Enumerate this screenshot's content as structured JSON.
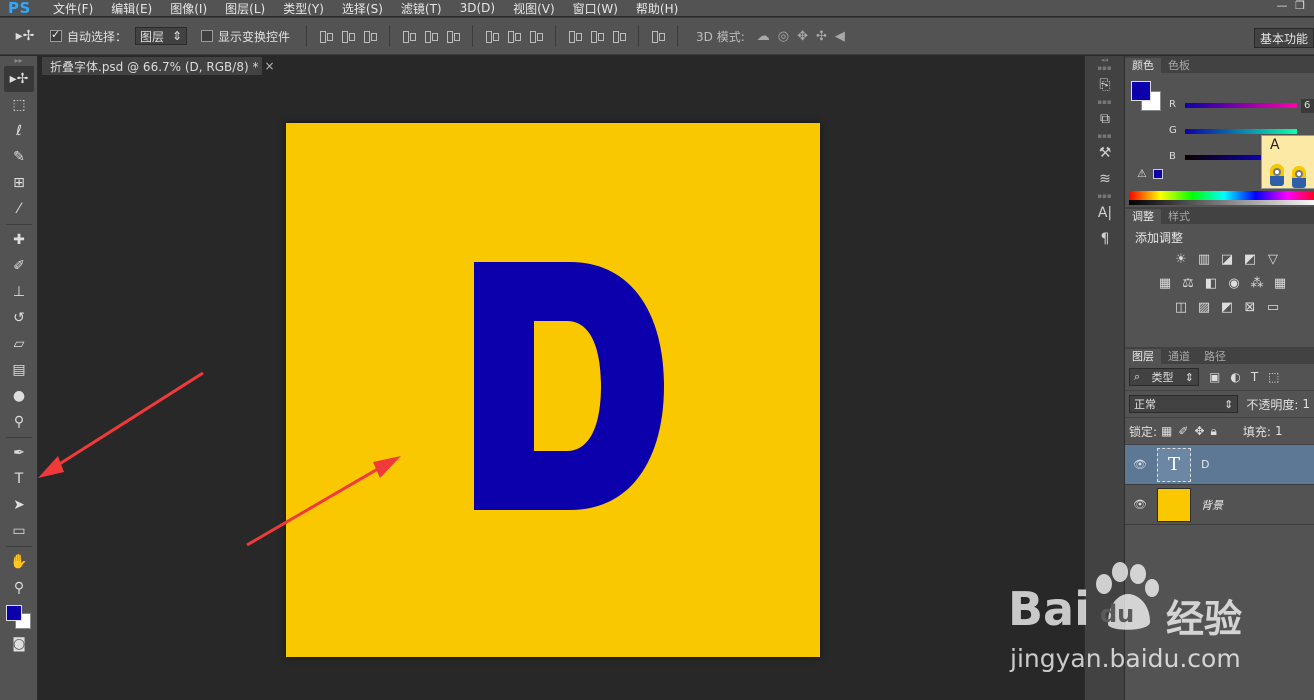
{
  "app": {
    "logo": "PS"
  },
  "menu": [
    "文件(F)",
    "编辑(E)",
    "图像(I)",
    "图层(L)",
    "类型(Y)",
    "选择(S)",
    "滤镜(T)",
    "3D(D)",
    "视图(V)",
    "窗口(W)",
    "帮助(H)"
  ],
  "window_controls": [
    "—",
    "❐"
  ],
  "options": {
    "auto_select_label": "自动选择：",
    "auto_select_value": "图层",
    "show_transform_label": "显示变换控件",
    "mode3d_label": "3D 模式:",
    "workspace_label": "基本功能"
  },
  "document": {
    "tab_title": "折叠字体.psd @ 66.7% (D, RGB/8) *",
    "close_symbol": "×",
    "canvas_color": "#fac800",
    "text_color": "#0c00ac",
    "letter": "D"
  },
  "color_panel": {
    "tabs": [
      "颜色",
      "色板"
    ],
    "channels": [
      "R",
      "G",
      "B"
    ],
    "r_value": "6",
    "thumb_letter": "A",
    "foreground": "#0c00ac",
    "background": "#ffffff"
  },
  "adjustments_panel": {
    "tabs": [
      "调整",
      "样式"
    ],
    "title": "添加调整"
  },
  "layers_panel": {
    "tabs": [
      "图层",
      "通道",
      "路径"
    ],
    "filter_label": "类型",
    "blend_mode": "正常",
    "opacity_label": "不透明度:",
    "opacity_value": "1",
    "lock_label": "锁定:",
    "fill_label": "填充:",
    "fill_value": "1",
    "layers": [
      {
        "name": "D",
        "type": "text",
        "selected": true
      },
      {
        "name": "背景",
        "type": "fill",
        "selected": false
      }
    ]
  },
  "watermark": {
    "brand": "Bai",
    "brand2": "du",
    "cn": "经验",
    "url": "jingyan.baidu.com"
  }
}
